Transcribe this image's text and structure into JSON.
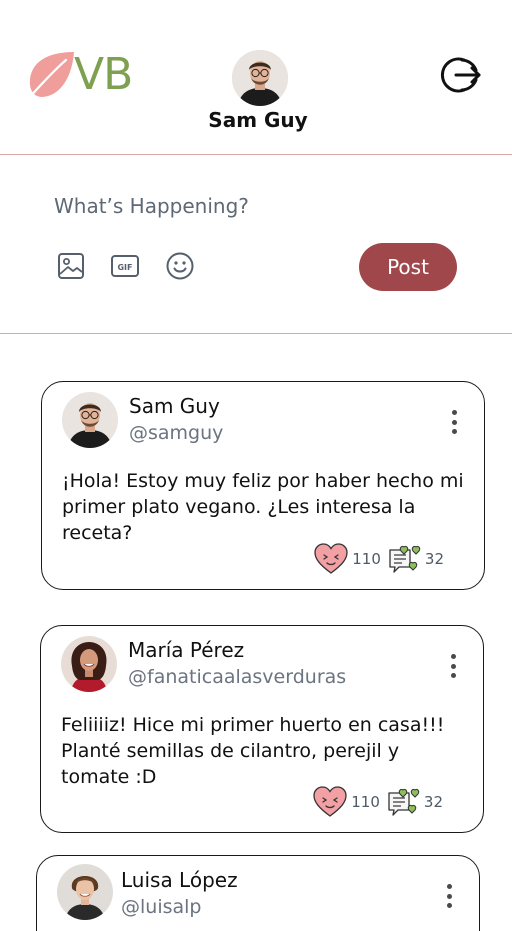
{
  "header": {
    "logo_text": "VB",
    "user_name": "Sam Guy"
  },
  "composer": {
    "placeholder": "What’s Happening?",
    "post_label": "Post",
    "tools": [
      "image-icon",
      "gif-icon",
      "emoji-icon"
    ]
  },
  "colors": {
    "brand_green": "#7ea050",
    "brand_leaf": "#ef9e9b",
    "post_button": "#a0474b",
    "divider": "#d9a8a5"
  },
  "posts": [
    {
      "name": "Sam Guy",
      "handle": "@samguy",
      "text": "¡Hola! Estoy muy feliz por haber hecho mi primer plato vegano. ¿Les interesa la receta?",
      "likes": "110",
      "comments": "32"
    },
    {
      "name": "María Pérez",
      "handle": "@fanaticaalasverduras",
      "text": "Feliiiiz!  Hice mi primer huerto en casa!!! Planté semillas de cilantro, perejil y tomate :D",
      "likes": "110",
      "comments": "32"
    },
    {
      "name": "Luisa López",
      "handle": "@luisalp",
      "text": "",
      "likes": "",
      "comments": ""
    }
  ]
}
